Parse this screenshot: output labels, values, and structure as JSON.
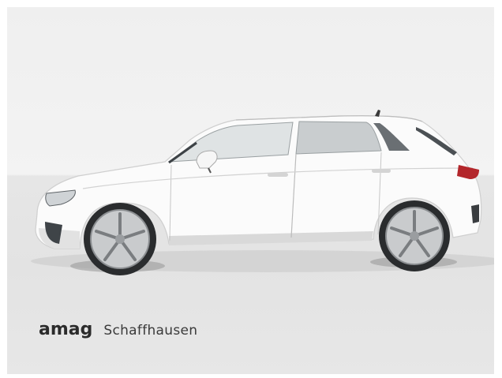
{
  "photo": {
    "subject_icon": "car-side-view-icon",
    "background_top_color": "#f1f1f1",
    "floor_color": "#e4e4e4",
    "car_color": "#ffffff"
  },
  "dealer": {
    "brand": "amag",
    "location": "Schaffhausen"
  }
}
